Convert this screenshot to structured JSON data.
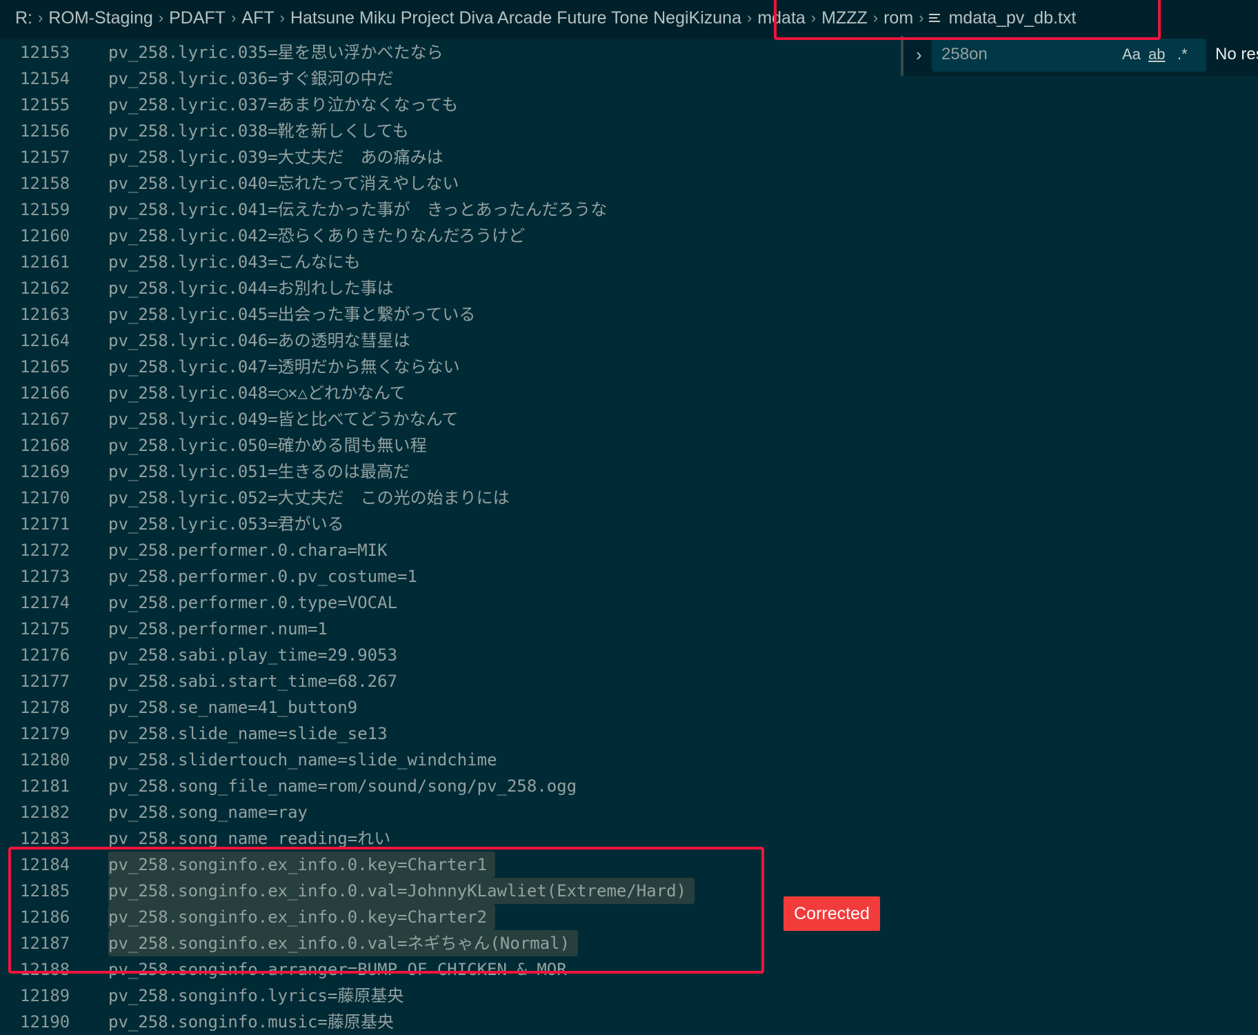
{
  "breadcrumb": {
    "items": [
      "R:",
      "ROM-Staging",
      "PDAFT",
      "AFT",
      "Hatsune Miku Project Diva Arcade Future Tone NegiKizuna",
      "mdata",
      "MZZZ",
      "rom"
    ],
    "file": "mdata_pv_db.txt",
    "file_icon": "list-lines-icon"
  },
  "find": {
    "value": "258on",
    "match_case": "Aa",
    "whole_word": "ab",
    "regex": ".*",
    "status": "No res"
  },
  "annotation": {
    "label": "Corrected",
    "color": "#f23b3b",
    "box_color": "#f0143c"
  },
  "lines": [
    {
      "n": "12153",
      "t": "pv_258.lyric.035=星を思い浮かべたなら"
    },
    {
      "n": "12154",
      "t": "pv_258.lyric.036=すぐ銀河の中だ"
    },
    {
      "n": "12155",
      "t": "pv_258.lyric.037=あまり泣かなくなっても"
    },
    {
      "n": "12156",
      "t": "pv_258.lyric.038=靴を新しくしても"
    },
    {
      "n": "12157",
      "t": "pv_258.lyric.039=大丈夫だ　あの痛みは"
    },
    {
      "n": "12158",
      "t": "pv_258.lyric.040=忘れたって消えやしない"
    },
    {
      "n": "12159",
      "t": "pv_258.lyric.041=伝えたかった事が　きっとあったんだろうな"
    },
    {
      "n": "12160",
      "t": "pv_258.lyric.042=恐らくありきたりなんだろうけど"
    },
    {
      "n": "12161",
      "t": "pv_258.lyric.043=こんなにも"
    },
    {
      "n": "12162",
      "t": "pv_258.lyric.044=お別れした事は"
    },
    {
      "n": "12163",
      "t": "pv_258.lyric.045=出会った事と繋がっている"
    },
    {
      "n": "12164",
      "t": "pv_258.lyric.046=あの透明な彗星は"
    },
    {
      "n": "12165",
      "t": "pv_258.lyric.047=透明だから無くならない"
    },
    {
      "n": "12166",
      "t": "pv_258.lyric.048=◯×△どれかなんて"
    },
    {
      "n": "12167",
      "t": "pv_258.lyric.049=皆と比べてどうかなんて"
    },
    {
      "n": "12168",
      "t": "pv_258.lyric.050=確かめる間も無い程"
    },
    {
      "n": "12169",
      "t": "pv_258.lyric.051=生きるのは最高だ"
    },
    {
      "n": "12170",
      "t": "pv_258.lyric.052=大丈夫だ　この光の始まりには"
    },
    {
      "n": "12171",
      "t": "pv_258.lyric.053=君がいる"
    },
    {
      "n": "12172",
      "t": "pv_258.performer.0.chara=MIK"
    },
    {
      "n": "12173",
      "t": "pv_258.performer.0.pv_costume=1"
    },
    {
      "n": "12174",
      "t": "pv_258.performer.0.type=VOCAL"
    },
    {
      "n": "12175",
      "t": "pv_258.performer.num=1"
    },
    {
      "n": "12176",
      "t": "pv_258.sabi.play_time=29.9053"
    },
    {
      "n": "12177",
      "t": "pv_258.sabi.start_time=68.267"
    },
    {
      "n": "12178",
      "t": "pv_258.se_name=41_button9"
    },
    {
      "n": "12179",
      "t": "pv_258.slide_name=slide_se13"
    },
    {
      "n": "12180",
      "t": "pv_258.slidertouch_name=slide_windchime"
    },
    {
      "n": "12181",
      "t": "pv_258.song_file_name=rom/sound/song/pv_258.ogg"
    },
    {
      "n": "12182",
      "t": "pv_258.song_name=ray"
    },
    {
      "n": "12183",
      "t": "pv_258.song_name_reading=れい"
    },
    {
      "n": "12184",
      "t": "pv_258.songinfo.ex_info.0.key=Charter1",
      "hl": true
    },
    {
      "n": "12185",
      "t": "pv_258.songinfo.ex_info.0.val=JohnnyKLawliet(Extreme/Hard)",
      "hl": true
    },
    {
      "n": "12186",
      "t": "pv_258.songinfo.ex_info.0.key=Charter2",
      "hl": true
    },
    {
      "n": "12187",
      "t": "pv_258.songinfo.ex_info.0.val=ネギちゃん(Normal)",
      "hl": true
    },
    {
      "n": "12188",
      "t": "pv_258.songinfo.arranger=BUMP OF CHICKEN & MOR"
    },
    {
      "n": "12189",
      "t": "pv_258.songinfo.lyrics=藤原基央"
    },
    {
      "n": "12190",
      "t": "pv_258.songinfo.music=藤原基央"
    }
  ]
}
